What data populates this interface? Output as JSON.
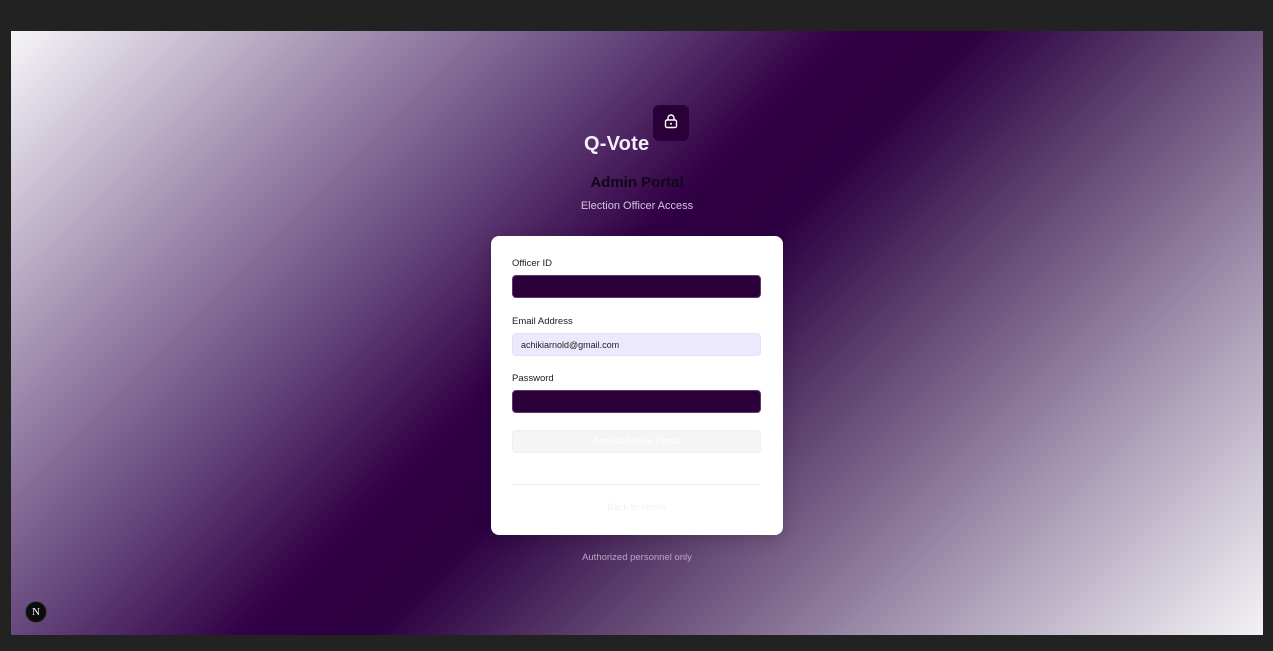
{
  "brand": {
    "name": "Q-Vote",
    "icon": "lock-icon"
  },
  "header": {
    "title": "Admin Portal",
    "subtitle": "Election Officer Access"
  },
  "form": {
    "officer_id": {
      "label": "Officer ID",
      "value": "",
      "placeholder": ""
    },
    "email": {
      "label": "Email Address",
      "value": "achikiarnold@gmail.com"
    },
    "password": {
      "label": "Password",
      "value": "",
      "placeholder": ""
    },
    "submit_label": "Access Admin Portal",
    "back_label": "Back to Home"
  },
  "footer": {
    "note": "Authorized personnel only"
  },
  "dev_indicator": {
    "letter": "N"
  },
  "colors": {
    "accent": "#2c0038",
    "input_light": "#ece8fd"
  }
}
